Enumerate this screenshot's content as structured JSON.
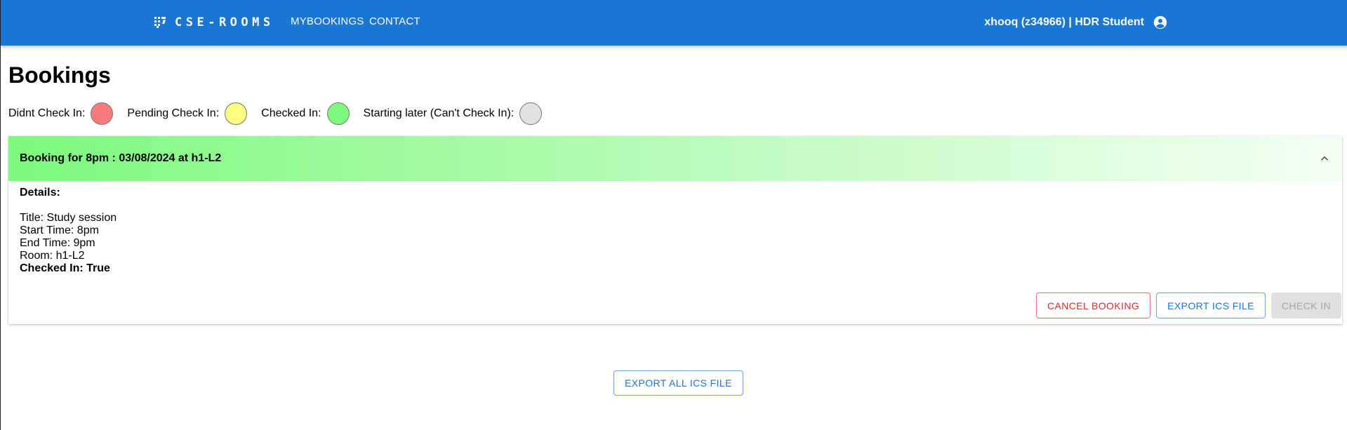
{
  "appbar": {
    "brand": "CSE-ROOMS",
    "nav": [
      "MYBOOKINGS",
      "CONTACT"
    ],
    "user": "xhooq (z34966) | HDR Student"
  },
  "page": {
    "title": "Bookings"
  },
  "legend": [
    {
      "label": "Didnt Check In:",
      "color": "#f87b7b"
    },
    {
      "label": "Pending Check In:",
      "color": "#fdfd82"
    },
    {
      "label": "Checked In:",
      "color": "#7dfa7d"
    },
    {
      "label": "Starting later (Can't Check In):",
      "color": "#e2e2e2"
    }
  ],
  "booking": {
    "summary": "Booking for 8pm : 03/08/2024 at h1-L2",
    "details_heading": "Details:",
    "lines": [
      "Title: Study session",
      "Start Time: 8pm",
      "End Time: 9pm",
      "Room: h1-L2"
    ],
    "checked_in": "Checked In: True",
    "status_color": "#7dfa7d",
    "actions": {
      "cancel": "CANCEL BOOKING",
      "export": "EXPORT ICS FILE",
      "checkin": "CHECK IN"
    }
  },
  "footer": {
    "export_all": "EXPORT ALL ICS FILE"
  }
}
